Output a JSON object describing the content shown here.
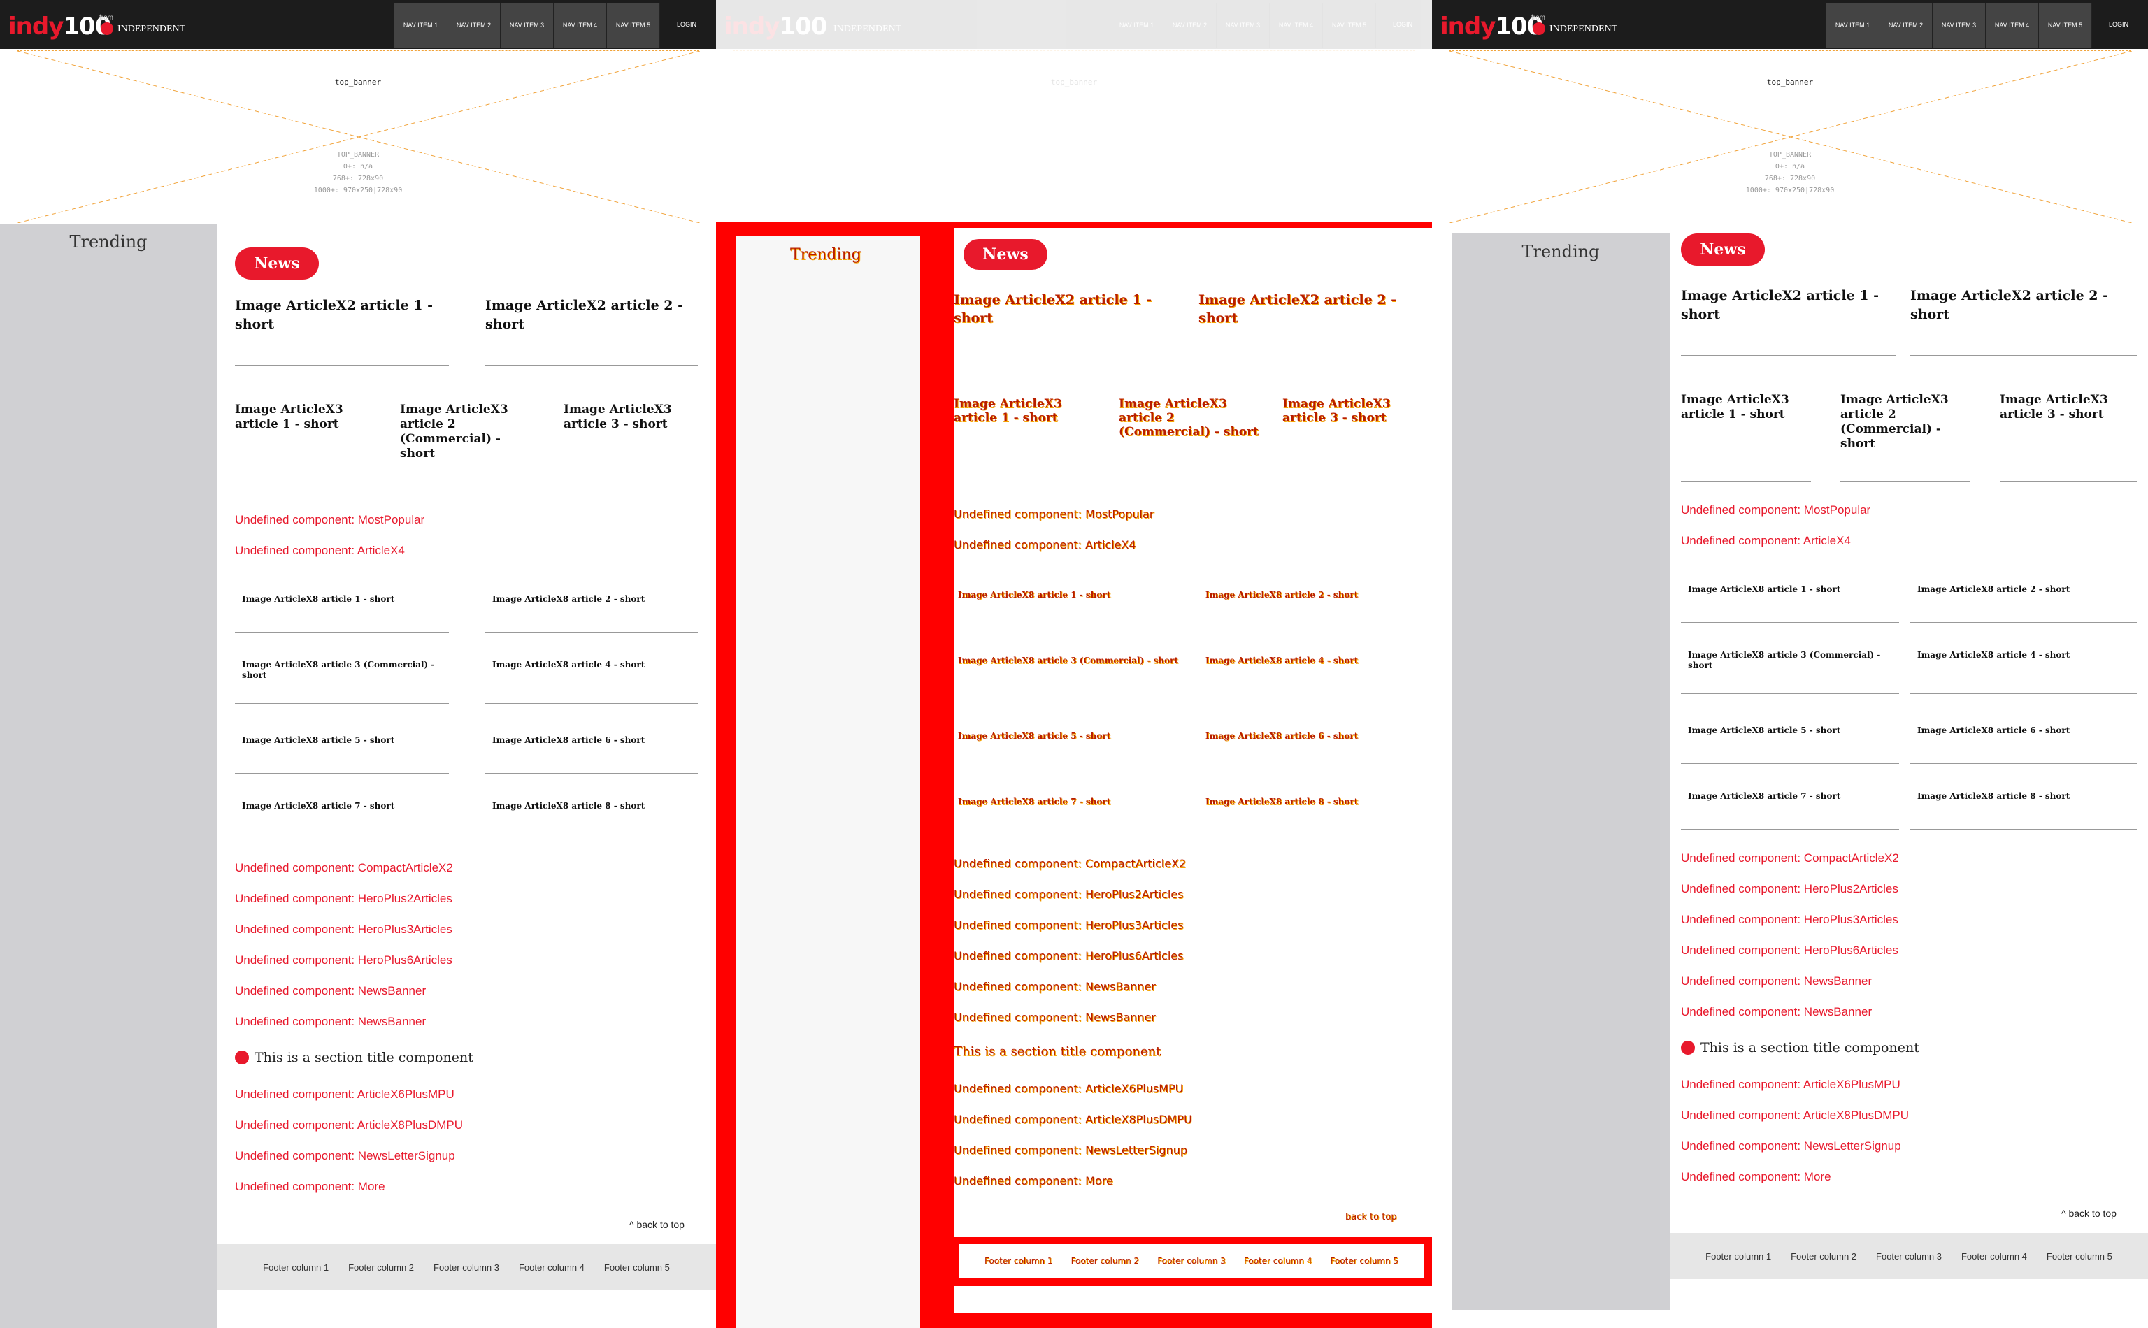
{
  "header": {
    "brand": "indy",
    "brand_num": "100",
    "from": "from",
    "publisher": "INDEPENDENT",
    "nav": [
      "NAV ITEM 1",
      "NAV ITEM 2",
      "NAV ITEM 3",
      "NAV ITEM 4",
      "NAV ITEM 5"
    ],
    "login": "LOGIN"
  },
  "banner": {
    "tag": "top_banner",
    "info": [
      "TOP_BANNER",
      "0+: n/a",
      "768+: 728x90",
      "1000+: 970x250|728x90"
    ]
  },
  "sidebar": {
    "title": "Trending"
  },
  "section": {
    "pill": "News"
  },
  "x2": [
    "Image ArticleX2 article 1 - short",
    "Image ArticleX2 article 2 - short"
  ],
  "x3": [
    "Image ArticleX3 article 1 - short",
    "Image ArticleX3 article 2 (Commercial) - short",
    "Image ArticleX3 article 3 - short"
  ],
  "undefined_a": [
    "Undefined component: MostPopular",
    "Undefined component: ArticleX4"
  ],
  "x8": [
    "Image ArticleX8 article 1 - short",
    "Image ArticleX8 article 2 - short",
    "Image ArticleX8 article 3 (Commercial) - short",
    "Image ArticleX8 article 4 - short",
    "Image ArticleX8 article 5 - short",
    "Image ArticleX8 article 6 - short",
    "Image ArticleX8 article 7 - short",
    "Image ArticleX8 article 8 - short"
  ],
  "undefined_b": [
    "Undefined component: CompactArticleX2",
    "Undefined component: HeroPlus2Articles",
    "Undefined component: HeroPlus3Articles",
    "Undefined component: HeroPlus6Articles",
    "Undefined component: NewsBanner",
    "Undefined component: NewsBanner"
  ],
  "section_title": "This is a section title component",
  "undefined_c": [
    "Undefined component: ArticleX6PlusMPU",
    "Undefined component: ArticleX8PlusDMPU",
    "Undefined component: NewsLetterSignup",
    "Undefined component: More"
  ],
  "back_to_top": "back to top",
  "footer": [
    "Footer column 1",
    "Footer column 2",
    "Footer column 3",
    "Footer column 4",
    "Footer column 5"
  ],
  "colors": {
    "brand_red": "#e8192c",
    "header_bg": "#1c1c1c",
    "sidebar_bg": "#d0d0d3",
    "banner_border": "#f1a33a"
  }
}
